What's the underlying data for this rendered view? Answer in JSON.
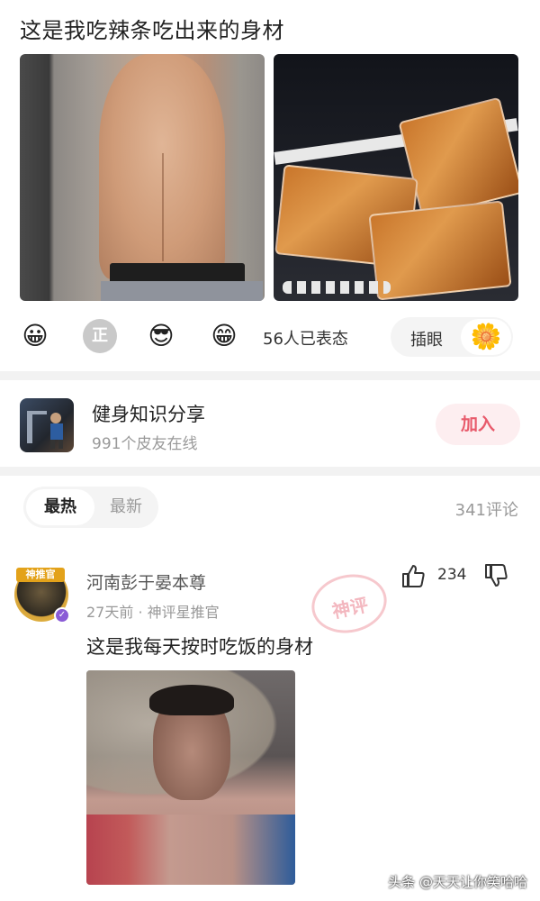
{
  "post": {
    "title": "这是我吃辣条吃出来的身材"
  },
  "reactions": {
    "count_text": "56人已表态",
    "chayan_label": "插眼",
    "zheng_label": "正",
    "emojis": [
      "😀",
      "正",
      "😎",
      "😁"
    ],
    "flower": "🌼"
  },
  "group": {
    "name": "健身知识分享",
    "online": "991个皮友在线",
    "join_label": "加入"
  },
  "tabs": {
    "hot": "最热",
    "new": "最新",
    "comment_total": "341评论"
  },
  "comment": {
    "badge": "神推官",
    "author": "河南彭于晏本尊",
    "meta": "27天前 · 神评星推官",
    "text": "这是我每天按时吃饭的身材",
    "likes": "234",
    "stamp": "神评"
  },
  "watermark": "头条 @天天让你笑哈哈",
  "colors": {
    "accent_pink": "#e85a6b",
    "join_bg": "#fdeef0",
    "verified_purple": "#8a5bd6",
    "badge_gold": "#e3a21a"
  }
}
